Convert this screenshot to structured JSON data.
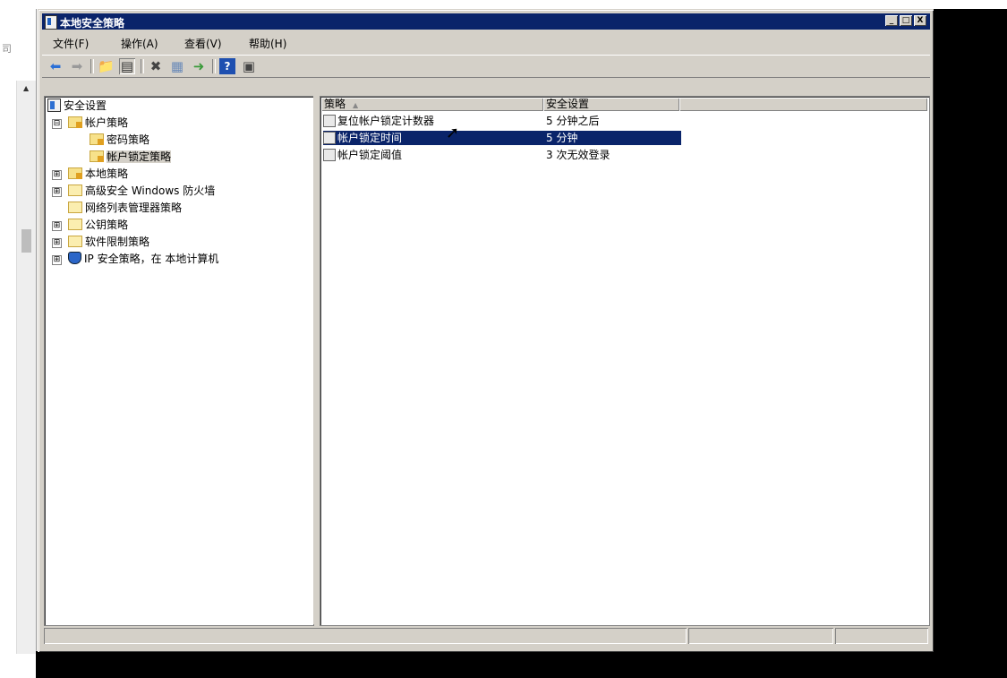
{
  "window": {
    "title": "本地安全策略",
    "buttons": [
      "_",
      "□",
      "X"
    ]
  },
  "menu": {
    "items": [
      "文件(F)",
      "操作(A)",
      "查看(V)",
      "帮助(H)"
    ]
  },
  "toolbar": {
    "buttons": [
      "back-icon",
      "forward-icon",
      "up-folder-icon",
      "show-tree-icon",
      "delete-icon",
      "properties-icon",
      "export-icon",
      "help-icon",
      "console-icon"
    ]
  },
  "tree": {
    "root": "安全设置",
    "items": [
      {
        "label": "帐户策略",
        "expander": "⊟",
        "level": 1
      },
      {
        "label": "密码策略",
        "expander": "",
        "level": 2
      },
      {
        "label": "帐户锁定策略",
        "expander": "",
        "level": 2
      },
      {
        "label": "本地策略",
        "expander": "⊞",
        "level": 1
      },
      {
        "label": "高级安全 Windows 防火墙",
        "expander": "⊞",
        "level": 1
      },
      {
        "label": "网络列表管理器策略",
        "expander": "",
        "level": 1
      },
      {
        "label": "公钥策略",
        "expander": "⊞",
        "level": 1
      },
      {
        "label": "软件限制策略",
        "expander": "⊞",
        "level": 1
      },
      {
        "label": "IP 安全策略，在 本地计算机",
        "expander": "⊞",
        "level": 1
      }
    ]
  },
  "list": {
    "columns": [
      "策略",
      "安全设置"
    ],
    "rows": [
      {
        "policy": "复位帐户锁定计数器",
        "setting": "5 分钟之后"
      },
      {
        "policy": "帐户锁定时间",
        "setting": "5 分钟"
      },
      {
        "policy": "帐户锁定阈值",
        "setting": "3 次无效登录"
      }
    ],
    "selected_index": 1
  },
  "left_strip": {
    "edge_char": "司"
  }
}
